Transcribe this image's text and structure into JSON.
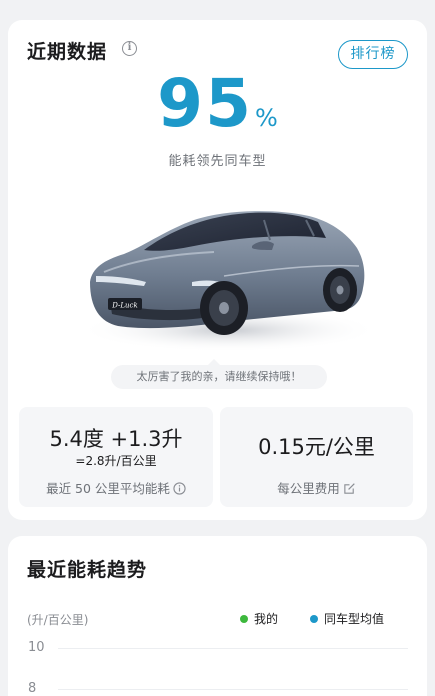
{
  "recent": {
    "title": "近期数据",
    "rank_button": "排行榜",
    "percent_value": "95",
    "percent_unit": "%",
    "percent_caption": "能耗领先同车型",
    "encourage_text": "太厉害了我的亲，请继续保持哦！",
    "energy": {
      "main": "5.4度 +1.3升",
      "sub": "=2.8升/百公里",
      "label": "最近 50 公里平均能耗"
    },
    "cost": {
      "main": "0.15元/公里",
      "label": "每公里费用"
    }
  },
  "trend": {
    "title": "最近能耗趋势",
    "unit": "(升/百公里)",
    "legend": [
      {
        "label": "我的",
        "color": "#3db83d"
      },
      {
        "label": "同车型均值",
        "color": "#1d98c9"
      }
    ],
    "y_ticks": [
      "10",
      "8"
    ]
  },
  "colors": {
    "accent": "#1d98c9",
    "mine": "#3db83d"
  },
  "icons": {
    "info": "info-icon",
    "help": "info-circle-icon",
    "edit": "edit-icon"
  }
}
